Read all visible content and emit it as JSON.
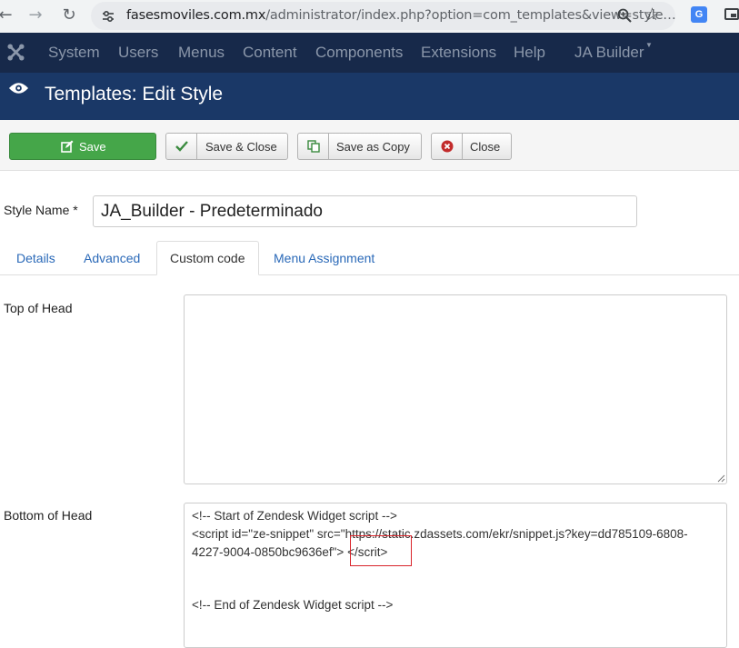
{
  "browser": {
    "url_host": "fasesmoviles.com.mx",
    "url_path": "/administrator/index.php?option=com_templates&view=style…",
    "icons": [
      "back-arrow-icon",
      "forward-arrow-icon",
      "reload-icon",
      "site-settings-icon",
      "zoom-icon",
      "bookmark-star-icon",
      "google-translate-icon",
      "picture-in-picture-icon"
    ]
  },
  "topnav": {
    "items": [
      "System",
      "Users",
      "Menus",
      "Content",
      "Components",
      "Extensions",
      "Help",
      "JA Builder"
    ]
  },
  "header": {
    "title": "Templates: Edit Style"
  },
  "toolbar": {
    "save": "Save",
    "save_close": "Save & Close",
    "save_copy": "Save as Copy",
    "close": "Close"
  },
  "form": {
    "style_name_label": "Style Name *",
    "style_name_value": "JA_Builder - Predeterminado",
    "tabs": [
      "Details",
      "Advanced",
      "Custom code",
      "Menu Assignment"
    ],
    "active_tab": "Custom code",
    "top_of_head_label": "Top of Head",
    "top_of_head_value": "",
    "bottom_of_head_label": "Bottom of Head",
    "bottom_of_head_lines": [
      "<!-- Start of  Zendesk Widget script -->",
      "<script id=\"ze-snippet\" src=\"https://static.zdassets.com/ekr/snippet.js?key=dd785109-6808-",
      "4227-9004-0850bc9636ef\"> </scrit>",
      "",
      "<!-- End of  Zendesk Widget script -->"
    ]
  },
  "colors": {
    "nav_bg": "#17294a",
    "header_bg": "#1a3867",
    "save_green": "#45a649",
    "link_blue": "#2a69b8",
    "highlight_red": "#d9242a"
  }
}
